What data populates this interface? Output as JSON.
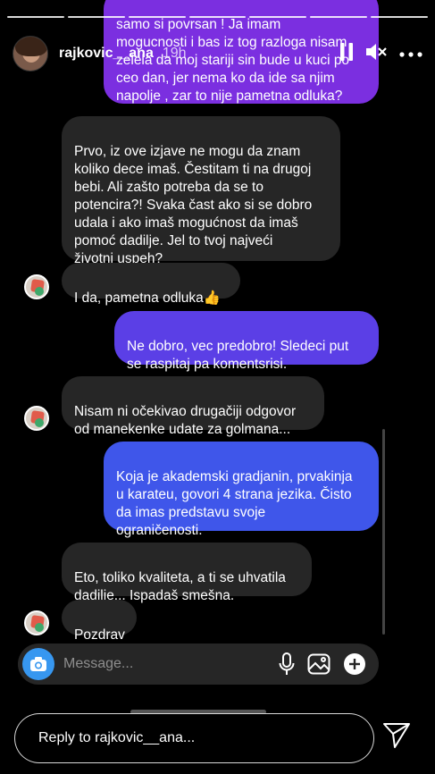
{
  "story": {
    "username": "rajkovic__ana",
    "time": "19h",
    "progress_segments": 7,
    "reply_placeholder": "Reply to rajkovic__ana..."
  },
  "chat": {
    "messages": [
      {
        "type": "out",
        "text": "samo si povrsan ! Ja imam\nmogucnosti i bas iz tog razloga nisam\nzelela da moj stariji sin bude u kuci po\nceo dan, jer nema ko da ide sa njim\nnapolje , zar to nije pametna odluka?",
        "color": "#7b2fe0"
      },
      {
        "type": "in",
        "text": "Prvo, iz ove izjave ne mogu da znam\nkoliko dece imaš. Čestitam ti na drugoj\nbebi. Ali zašto potreba da se to\npotencira?! Svaka čast ako si se dobro\nudala i ako imaš mogućnost da imaš\npomoć dadilje. Jel to tvoj najveći\nživotni uspeh?"
      },
      {
        "type": "in",
        "text": "I da, pametna odluka👍"
      },
      {
        "type": "out",
        "text": "Ne dobro, vec predobro! Sledeci put\nse raspitaj pa komentsrisi.",
        "color": "#5b3fe6"
      },
      {
        "type": "in",
        "text": "Nisam ni očekivao drugačiji odgovor\nod manekenke udate za golmana..."
      },
      {
        "type": "out",
        "text": "Koja je akademski gradjanin, prvakinja\nu karateu, govori 4 strana jezika. Čisto\nda imas predstavu svoje\nograničenosti.",
        "color": "#3f56ea"
      },
      {
        "type": "in",
        "text": "Eto, toliko kvaliteta, a ti se uhvatila\ndadilje... Ispadaš smešna."
      },
      {
        "type": "in",
        "text": "Pozdrav"
      }
    ],
    "composer_placeholder": "Message..."
  },
  "icons": {
    "pause": "pause-icon",
    "mute": "speaker-muted-icon",
    "more": "more-icon",
    "camera": "camera-icon",
    "mic": "microphone-icon",
    "gallery": "gallery-icon",
    "plus": "plus-icon",
    "send": "send-icon"
  },
  "colors": {
    "incoming_bubble": "#262626",
    "accent_camera": "#3797f0",
    "background": "#000000"
  }
}
